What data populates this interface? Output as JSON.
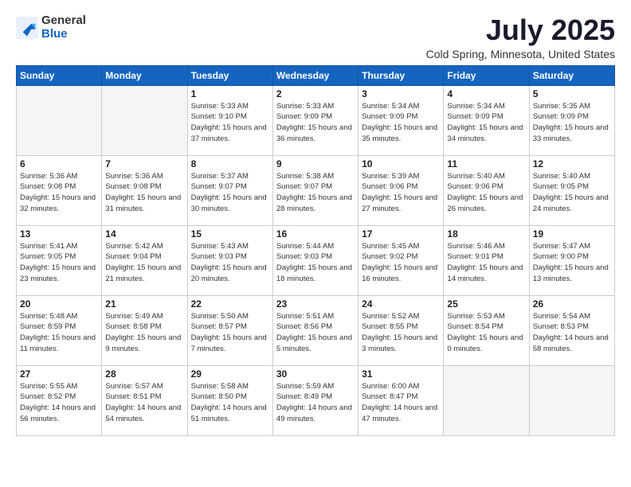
{
  "logo": {
    "general": "General",
    "blue": "Blue"
  },
  "title": {
    "month": "July 2025",
    "location": "Cold Spring, Minnesota, United States"
  },
  "weekdays": [
    "Sunday",
    "Monday",
    "Tuesday",
    "Wednesday",
    "Thursday",
    "Friday",
    "Saturday"
  ],
  "weeks": [
    [
      {
        "day": "",
        "sunrise": "",
        "sunset": "",
        "daylight": ""
      },
      {
        "day": "",
        "sunrise": "",
        "sunset": "",
        "daylight": ""
      },
      {
        "day": "1",
        "sunrise": "Sunrise: 5:33 AM",
        "sunset": "Sunset: 9:10 PM",
        "daylight": "Daylight: 15 hours and 37 minutes."
      },
      {
        "day": "2",
        "sunrise": "Sunrise: 5:33 AM",
        "sunset": "Sunset: 9:09 PM",
        "daylight": "Daylight: 15 hours and 36 minutes."
      },
      {
        "day": "3",
        "sunrise": "Sunrise: 5:34 AM",
        "sunset": "Sunset: 9:09 PM",
        "daylight": "Daylight: 15 hours and 35 minutes."
      },
      {
        "day": "4",
        "sunrise": "Sunrise: 5:34 AM",
        "sunset": "Sunset: 9:09 PM",
        "daylight": "Daylight: 15 hours and 34 minutes."
      },
      {
        "day": "5",
        "sunrise": "Sunrise: 5:35 AM",
        "sunset": "Sunset: 9:09 PM",
        "daylight": "Daylight: 15 hours and 33 minutes."
      }
    ],
    [
      {
        "day": "6",
        "sunrise": "Sunrise: 5:36 AM",
        "sunset": "Sunset: 9:08 PM",
        "daylight": "Daylight: 15 hours and 32 minutes."
      },
      {
        "day": "7",
        "sunrise": "Sunrise: 5:36 AM",
        "sunset": "Sunset: 9:08 PM",
        "daylight": "Daylight: 15 hours and 31 minutes."
      },
      {
        "day": "8",
        "sunrise": "Sunrise: 5:37 AM",
        "sunset": "Sunset: 9:07 PM",
        "daylight": "Daylight: 15 hours and 30 minutes."
      },
      {
        "day": "9",
        "sunrise": "Sunrise: 5:38 AM",
        "sunset": "Sunset: 9:07 PM",
        "daylight": "Daylight: 15 hours and 28 minutes."
      },
      {
        "day": "10",
        "sunrise": "Sunrise: 5:39 AM",
        "sunset": "Sunset: 9:06 PM",
        "daylight": "Daylight: 15 hours and 27 minutes."
      },
      {
        "day": "11",
        "sunrise": "Sunrise: 5:40 AM",
        "sunset": "Sunset: 9:06 PM",
        "daylight": "Daylight: 15 hours and 26 minutes."
      },
      {
        "day": "12",
        "sunrise": "Sunrise: 5:40 AM",
        "sunset": "Sunset: 9:05 PM",
        "daylight": "Daylight: 15 hours and 24 minutes."
      }
    ],
    [
      {
        "day": "13",
        "sunrise": "Sunrise: 5:41 AM",
        "sunset": "Sunset: 9:05 PM",
        "daylight": "Daylight: 15 hours and 23 minutes."
      },
      {
        "day": "14",
        "sunrise": "Sunrise: 5:42 AM",
        "sunset": "Sunset: 9:04 PM",
        "daylight": "Daylight: 15 hours and 21 minutes."
      },
      {
        "day": "15",
        "sunrise": "Sunrise: 5:43 AM",
        "sunset": "Sunset: 9:03 PM",
        "daylight": "Daylight: 15 hours and 20 minutes."
      },
      {
        "day": "16",
        "sunrise": "Sunrise: 5:44 AM",
        "sunset": "Sunset: 9:03 PM",
        "daylight": "Daylight: 15 hours and 18 minutes."
      },
      {
        "day": "17",
        "sunrise": "Sunrise: 5:45 AM",
        "sunset": "Sunset: 9:02 PM",
        "daylight": "Daylight: 15 hours and 16 minutes."
      },
      {
        "day": "18",
        "sunrise": "Sunrise: 5:46 AM",
        "sunset": "Sunset: 9:01 PM",
        "daylight": "Daylight: 15 hours and 14 minutes."
      },
      {
        "day": "19",
        "sunrise": "Sunrise: 5:47 AM",
        "sunset": "Sunset: 9:00 PM",
        "daylight": "Daylight: 15 hours and 13 minutes."
      }
    ],
    [
      {
        "day": "20",
        "sunrise": "Sunrise: 5:48 AM",
        "sunset": "Sunset: 8:59 PM",
        "daylight": "Daylight: 15 hours and 11 minutes."
      },
      {
        "day": "21",
        "sunrise": "Sunrise: 5:49 AM",
        "sunset": "Sunset: 8:58 PM",
        "daylight": "Daylight: 15 hours and 9 minutes."
      },
      {
        "day": "22",
        "sunrise": "Sunrise: 5:50 AM",
        "sunset": "Sunset: 8:57 PM",
        "daylight": "Daylight: 15 hours and 7 minutes."
      },
      {
        "day": "23",
        "sunrise": "Sunrise: 5:51 AM",
        "sunset": "Sunset: 8:56 PM",
        "daylight": "Daylight: 15 hours and 5 minutes."
      },
      {
        "day": "24",
        "sunrise": "Sunrise: 5:52 AM",
        "sunset": "Sunset: 8:55 PM",
        "daylight": "Daylight: 15 hours and 3 minutes."
      },
      {
        "day": "25",
        "sunrise": "Sunrise: 5:53 AM",
        "sunset": "Sunset: 8:54 PM",
        "daylight": "Daylight: 15 hours and 0 minutes."
      },
      {
        "day": "26",
        "sunrise": "Sunrise: 5:54 AM",
        "sunset": "Sunset: 8:53 PM",
        "daylight": "Daylight: 14 hours and 58 minutes."
      }
    ],
    [
      {
        "day": "27",
        "sunrise": "Sunrise: 5:55 AM",
        "sunset": "Sunset: 8:52 PM",
        "daylight": "Daylight: 14 hours and 56 minutes."
      },
      {
        "day": "28",
        "sunrise": "Sunrise: 5:57 AM",
        "sunset": "Sunset: 8:51 PM",
        "daylight": "Daylight: 14 hours and 54 minutes."
      },
      {
        "day": "29",
        "sunrise": "Sunrise: 5:58 AM",
        "sunset": "Sunset: 8:50 PM",
        "daylight": "Daylight: 14 hours and 51 minutes."
      },
      {
        "day": "30",
        "sunrise": "Sunrise: 5:59 AM",
        "sunset": "Sunset: 8:49 PM",
        "daylight": "Daylight: 14 hours and 49 minutes."
      },
      {
        "day": "31",
        "sunrise": "Sunrise: 6:00 AM",
        "sunset": "Sunset: 8:47 PM",
        "daylight": "Daylight: 14 hours and 47 minutes."
      },
      {
        "day": "",
        "sunrise": "",
        "sunset": "",
        "daylight": ""
      },
      {
        "day": "",
        "sunrise": "",
        "sunset": "",
        "daylight": ""
      }
    ]
  ]
}
